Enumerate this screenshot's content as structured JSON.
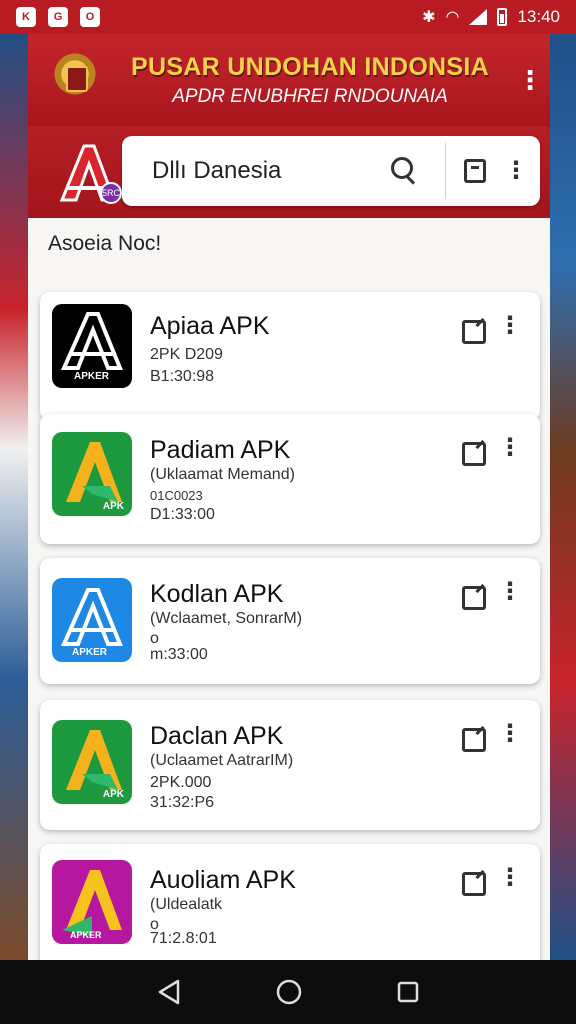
{
  "status_bar": {
    "time": "13:40",
    "left_icons": [
      "K",
      "G",
      "O"
    ]
  },
  "header": {
    "title": "PUSAR UNDOHAN INDONSIA",
    "subtitle": "APDR ENUBHREI RNDOUNAIA"
  },
  "search": {
    "value": "Dllı Danesia",
    "logo_badge": "5RC"
  },
  "section_title": "Asoeia Noc!",
  "apps": [
    {
      "name": "Apiaa APK",
      "line1": "2PK D209",
      "line2": "B1:30:98",
      "line3": "",
      "icon_bg": "#000000",
      "icon_fg": "#ffffff",
      "icon_label": "APKER"
    },
    {
      "name": "Padiam APK",
      "line1": "(Uklaamat Memand)",
      "line2": "01C0023",
      "line3": "D1:33:00",
      "icon_bg": "#1d9a3f",
      "icon_fg": "#f6b21c",
      "icon_label": "APK"
    },
    {
      "name": "Kodlan APK",
      "line1": "(Wclaamet, SonrarM)",
      "line2": "o",
      "line3": "m:33:00",
      "icon_bg": "#1e88e5",
      "icon_fg": "#ffffff",
      "icon_label": "APKER"
    },
    {
      "name": "Daclan APK",
      "line1": "(Uclaamet AatrarIM)",
      "line2": "2PK.000",
      "line3": "31:32:P6",
      "icon_bg": "#1d9a3f",
      "icon_fg": "#f6b21c",
      "icon_label": "APK"
    },
    {
      "name": "Auoliam APK",
      "line1": "(Uldealatk",
      "line2": "o",
      "line3": "71:2.8:01",
      "icon_bg": "#b5179e",
      "icon_fg": "#f6c21c",
      "icon_label": "APKER"
    }
  ]
}
